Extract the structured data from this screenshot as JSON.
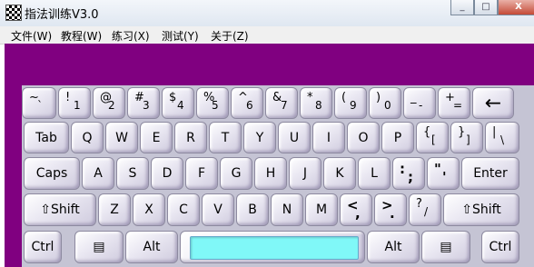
{
  "window": {
    "title": "指法训练V3.0",
    "minimize": "_",
    "maximize": "□",
    "close": "X"
  },
  "menu": [
    "文件(W)",
    "教程(W)",
    "练习(X)",
    "测试(Y)",
    "关于(Z)"
  ],
  "keys": {
    "row1": [
      {
        "up": "~",
        "dn": "`"
      },
      {
        "up": "!",
        "dn": "1"
      },
      {
        "up": "@",
        "dn": "2"
      },
      {
        "up": "#",
        "dn": "3"
      },
      {
        "up": "$",
        "dn": "4"
      },
      {
        "up": "%",
        "dn": "5"
      },
      {
        "up": "^",
        "dn": "6"
      },
      {
        "up": "&",
        "dn": "7"
      },
      {
        "up": "*",
        "dn": "8"
      },
      {
        "up": "(",
        "dn": "9"
      },
      {
        "up": ")",
        "dn": "0"
      },
      {
        "up": "_",
        "dn": "-"
      },
      {
        "up": "+",
        "dn": "="
      },
      {
        "label": "←"
      }
    ],
    "row2": [
      "Tab",
      "Q",
      "W",
      "E",
      "R",
      "T",
      "Y",
      "U",
      "I",
      "O",
      "P",
      {
        "up": "{",
        "dn": "["
      },
      {
        "up": "}",
        "dn": "]"
      },
      {
        "up": "|",
        "dn": "\\"
      }
    ],
    "row3": [
      "Caps",
      "A",
      "S",
      "D",
      "F",
      "G",
      "H",
      "J",
      "K",
      "L",
      {
        "up": ":",
        "dn": ";"
      },
      {
        "up": "\"",
        "dn": "'"
      },
      "Enter"
    ],
    "row4": [
      "⇧Shift",
      "Z",
      "X",
      "C",
      "V",
      "B",
      "N",
      "M",
      {
        "up": "<",
        "dn": ","
      },
      {
        "up": ">",
        "dn": "."
      },
      {
        "up": "?",
        "dn": "/"
      },
      "⇧Shift"
    ],
    "row5": [
      "Ctrl",
      "▤",
      "Alt",
      "",
      "Alt",
      "▤",
      "Ctrl"
    ]
  },
  "colors": {
    "background": "#800080",
    "keyboard": "#c5c4d4",
    "space": "#80f8f8"
  }
}
